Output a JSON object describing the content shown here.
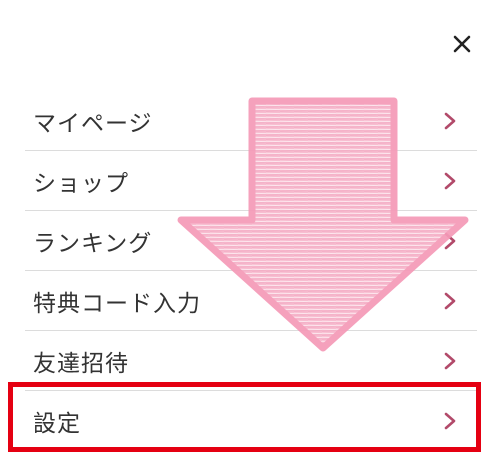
{
  "menu": {
    "items": [
      {
        "label": "マイページ"
      },
      {
        "label": "ショップ"
      },
      {
        "label": "ランキング"
      },
      {
        "label": "特典コード入力"
      },
      {
        "label": "友達招待"
      },
      {
        "label": "設定"
      }
    ]
  },
  "icons": {
    "close": "close-icon",
    "chevron": "chevron-right-icon",
    "annotation_arrow": "down-arrow-icon"
  },
  "colors": {
    "chevron": "#b24a6a",
    "highlight": "#e50012",
    "arrow_fill": "#f7b9cd",
    "arrow_stroke": "#f59ab8"
  }
}
